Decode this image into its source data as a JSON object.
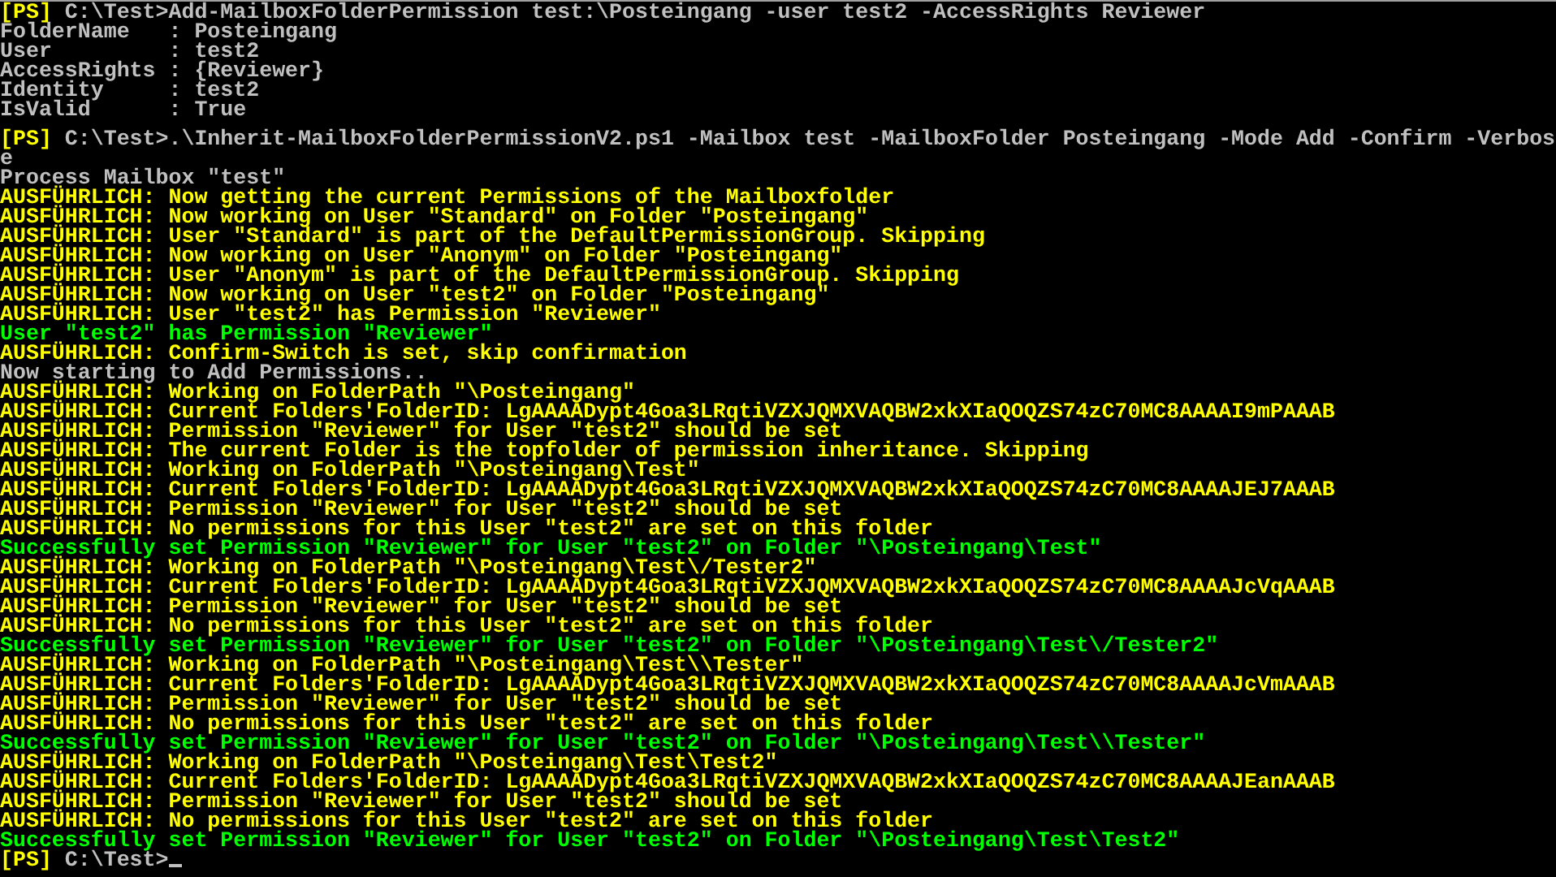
{
  "console": {
    "lines": [
      {
        "kind": "prompt",
        "prompt": "[PS]",
        "text": " C:\\Test>Add-MailboxFolderPermission test:\\Posteingang -user test2 -AccessRights Reviewer"
      },
      {
        "kind": "output",
        "text": "FolderName   : Posteingang"
      },
      {
        "kind": "output",
        "text": "User         : test2"
      },
      {
        "kind": "output",
        "text": "AccessRights : {Reviewer}"
      },
      {
        "kind": "output",
        "text": "Identity     : test2"
      },
      {
        "kind": "output",
        "text": "IsValid      : True"
      },
      {
        "kind": "prompt",
        "prompt": "[PS]",
        "text": " C:\\Test>.\\Inherit-MailboxFolderPermissionV2.ps1 -Mailbox test -MailboxFolder Posteingang -Mode Add -Confirm -Verbos"
      },
      {
        "kind": "output",
        "text": "e"
      },
      {
        "kind": "output",
        "text": "Process Mailbox \"test\""
      },
      {
        "kind": "verbose",
        "text": "AUSFÜHRLICH: Now getting the current Permissions of the Mailboxfolder"
      },
      {
        "kind": "verbose",
        "text": "AUSFÜHRLICH: Now working on User \"Standard\" on Folder \"Posteingang\""
      },
      {
        "kind": "verbose",
        "text": "AUSFÜHRLICH: User \"Standard\" is part of the DefaultPermissionGroup. Skipping"
      },
      {
        "kind": "verbose",
        "text": "AUSFÜHRLICH: Now working on User \"Anonym\" on Folder \"Posteingang\""
      },
      {
        "kind": "verbose",
        "text": "AUSFÜHRLICH: User \"Anonym\" is part of the DefaultPermissionGroup. Skipping"
      },
      {
        "kind": "verbose",
        "text": "AUSFÜHRLICH: Now working on User \"test2\" on Folder \"Posteingang\""
      },
      {
        "kind": "verbose",
        "text": "AUSFÜHRLICH: User \"test2\" has Permission \"Reviewer\""
      },
      {
        "kind": "success",
        "text": "User \"test2\" has Permission \"Reviewer\""
      },
      {
        "kind": "verbose",
        "text": "AUSFÜHRLICH: Confirm-Switch is set, skip confirmation"
      },
      {
        "kind": "output",
        "text": "Now starting to Add Permissions.."
      },
      {
        "kind": "verbose",
        "text": "AUSFÜHRLICH: Working on FolderPath \"\\Posteingang\""
      },
      {
        "kind": "verbose",
        "text": "AUSFÜHRLICH: Current Folders'FolderID: LgAAAADypt4Goa3LRqtiVZXJQMXVAQBW2xkXIaQOQZS74zC70MC8AAAAI9mPAAAB"
      },
      {
        "kind": "verbose",
        "text": "AUSFÜHRLICH: Permission \"Reviewer\" for User \"test2\" should be set"
      },
      {
        "kind": "verbose",
        "text": "AUSFÜHRLICH: The current Folder is the topfolder of permission inheritance. Skipping"
      },
      {
        "kind": "verbose",
        "text": "AUSFÜHRLICH: Working on FolderPath \"\\Posteingang\\Test\""
      },
      {
        "kind": "verbose",
        "text": "AUSFÜHRLICH: Current Folders'FolderID: LgAAAADypt4Goa3LRqtiVZXJQMXVAQBW2xkXIaQOQZS74zC70MC8AAAAJEJ7AAAB"
      },
      {
        "kind": "verbose",
        "text": "AUSFÜHRLICH: Permission \"Reviewer\" for User \"test2\" should be set"
      },
      {
        "kind": "verbose",
        "text": "AUSFÜHRLICH: No permissions for this User \"test2\" are set on this folder"
      },
      {
        "kind": "success",
        "text": "Successfully set Permission \"Reviewer\" for User \"test2\" on Folder \"\\Posteingang\\Test\""
      },
      {
        "kind": "verbose",
        "text": "AUSFÜHRLICH: Working on FolderPath \"\\Posteingang\\Test\\/Tester2\""
      },
      {
        "kind": "verbose",
        "text": "AUSFÜHRLICH: Current Folders'FolderID: LgAAAADypt4Goa3LRqtiVZXJQMXVAQBW2xkXIaQOQZS74zC70MC8AAAAJcVqAAAB"
      },
      {
        "kind": "verbose",
        "text": "AUSFÜHRLICH: Permission \"Reviewer\" for User \"test2\" should be set"
      },
      {
        "kind": "verbose",
        "text": "AUSFÜHRLICH: No permissions for this User \"test2\" are set on this folder"
      },
      {
        "kind": "success",
        "text": "Successfully set Permission \"Reviewer\" for User \"test2\" on Folder \"\\Posteingang\\Test\\/Tester2\""
      },
      {
        "kind": "verbose",
        "text": "AUSFÜHRLICH: Working on FolderPath \"\\Posteingang\\Test\\\\Tester\""
      },
      {
        "kind": "verbose",
        "text": "AUSFÜHRLICH: Current Folders'FolderID: LgAAAADypt4Goa3LRqtiVZXJQMXVAQBW2xkXIaQOQZS74zC70MC8AAAAJcVmAAAB"
      },
      {
        "kind": "verbose",
        "text": "AUSFÜHRLICH: Permission \"Reviewer\" for User \"test2\" should be set"
      },
      {
        "kind": "verbose",
        "text": "AUSFÜHRLICH: No permissions for this User \"test2\" are set on this folder"
      },
      {
        "kind": "success",
        "text": "Successfully set Permission \"Reviewer\" for User \"test2\" on Folder \"\\Posteingang\\Test\\\\Tester\""
      },
      {
        "kind": "verbose",
        "text": "AUSFÜHRLICH: Working on FolderPath \"\\Posteingang\\Test\\Test2\""
      },
      {
        "kind": "verbose",
        "text": "AUSFÜHRLICH: Current Folders'FolderID: LgAAAADypt4Goa3LRqtiVZXJQMXVAQBW2xkXIaQOQZS74zC70MC8AAAAJEanAAAB"
      },
      {
        "kind": "verbose",
        "text": "AUSFÜHRLICH: Permission \"Reviewer\" for User \"test2\" should be set"
      },
      {
        "kind": "verbose",
        "text": "AUSFÜHRLICH: No permissions for this User \"test2\" are set on this folder"
      },
      {
        "kind": "success",
        "text": "Successfully set Permission \"Reviewer\" for User \"test2\" on Folder \"\\Posteingang\\Test\\Test2\""
      },
      {
        "kind": "prompt",
        "prompt": "[PS]",
        "text": " C:\\Test>",
        "cursor": true
      }
    ]
  }
}
